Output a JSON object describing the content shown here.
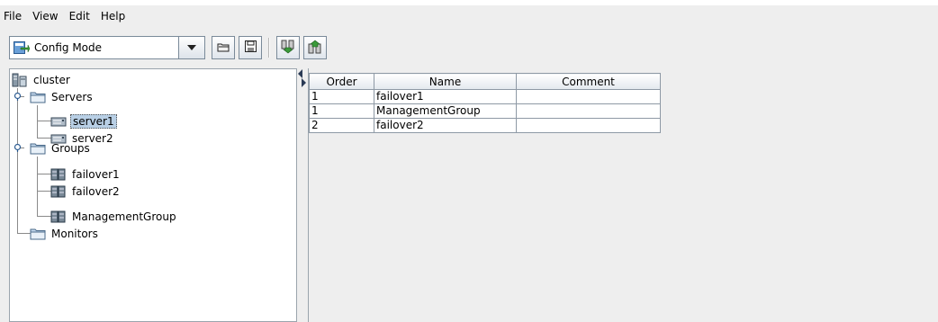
{
  "menu": {
    "items": [
      "File",
      "View",
      "Edit",
      "Help"
    ]
  },
  "toolbar": {
    "mode_label": "Config Mode",
    "buttons": [
      "open-icon",
      "save-icon",
      "download-icon",
      "upload-icon"
    ]
  },
  "tree": {
    "root": "cluster",
    "servers_label": "Servers",
    "servers": [
      "server1",
      "server2"
    ],
    "groups_label": "Groups",
    "groups": [
      "failover1",
      "failover2",
      "ManagementGroup"
    ],
    "monitors_label": "Monitors",
    "selected": "server1"
  },
  "table": {
    "headers": [
      "Order",
      "Name",
      "Comment"
    ],
    "rows": [
      {
        "order": "1",
        "name": "failover1",
        "comment": ""
      },
      {
        "order": "1",
        "name": "ManagementGroup",
        "comment": ""
      },
      {
        "order": "2",
        "name": "failover2",
        "comment": ""
      }
    ]
  },
  "colors": {
    "selection": "#b8cfe5",
    "folder": "#9cc0e6",
    "server": "#8a9aa8"
  }
}
